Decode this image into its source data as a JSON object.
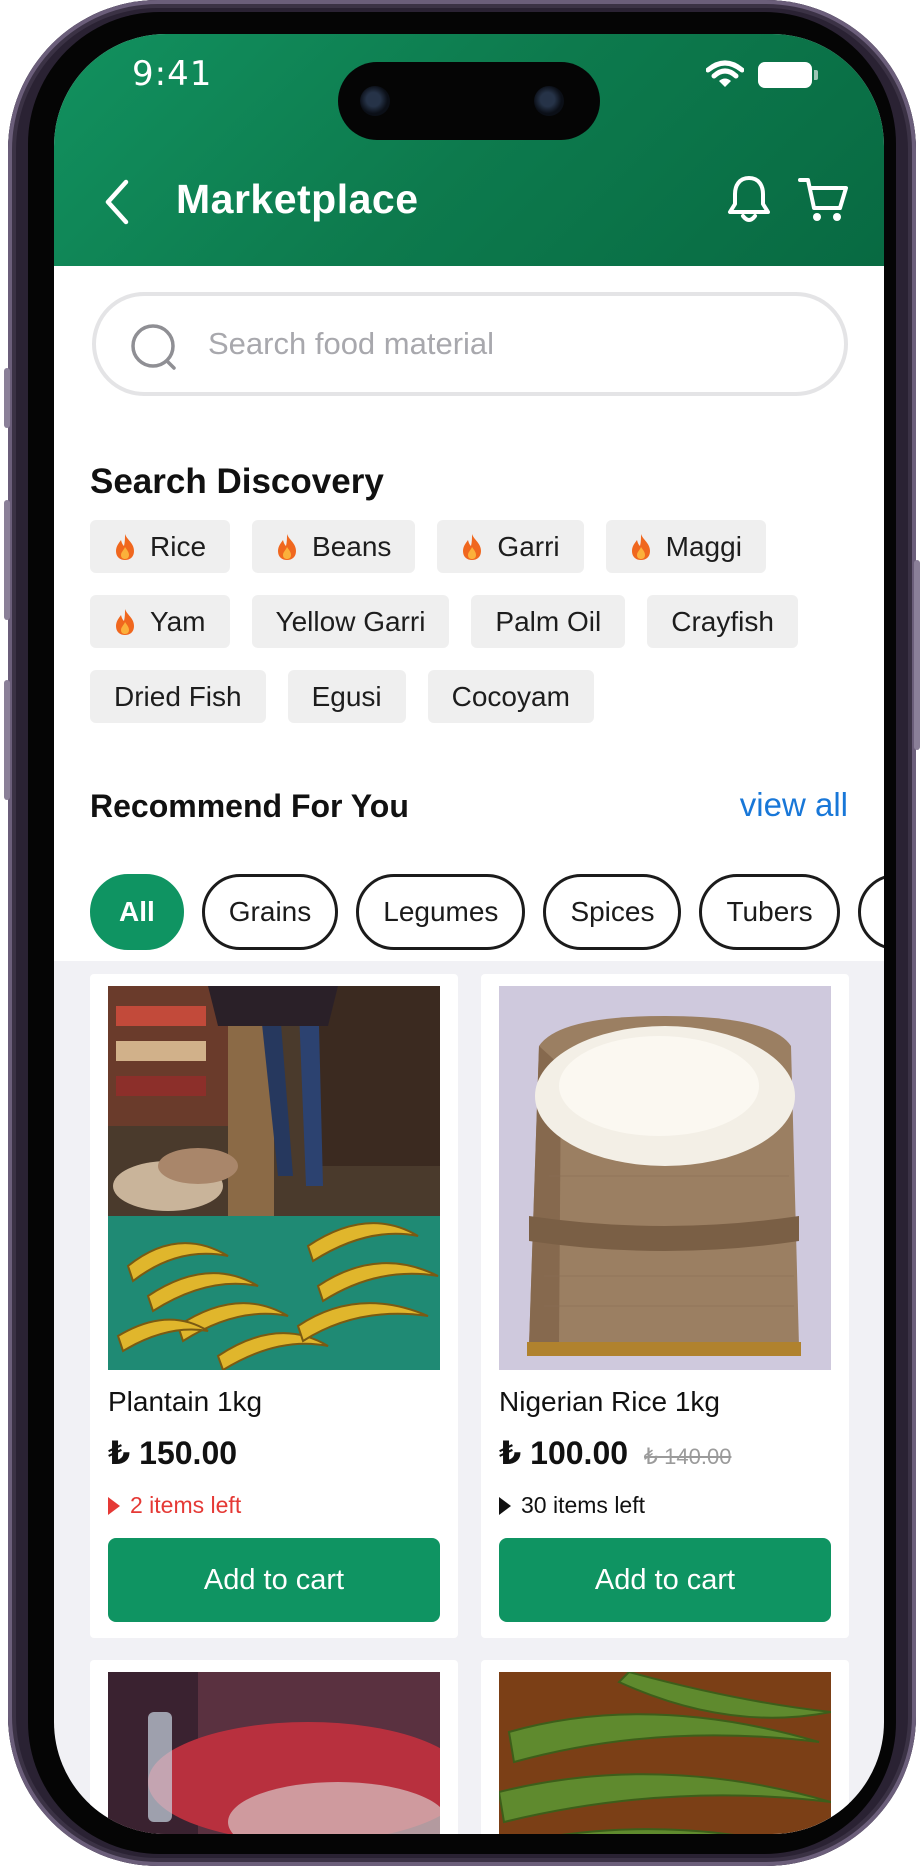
{
  "status_bar": {
    "time": "9:41"
  },
  "header": {
    "title": "Marketplace"
  },
  "search": {
    "placeholder": "Search food material"
  },
  "discovery": {
    "title": "Search Discovery",
    "rows": [
      [
        {
          "label": "Rice",
          "hot": true
        },
        {
          "label": "Beans",
          "hot": true
        },
        {
          "label": "Garri",
          "hot": true
        },
        {
          "label": "Maggi",
          "hot": true
        }
      ],
      [
        {
          "label": "Yam",
          "hot": true
        },
        {
          "label": "Yellow Garri",
          "hot": false
        },
        {
          "label": "Palm Oil",
          "hot": false
        },
        {
          "label": "Crayfish",
          "hot": false
        }
      ],
      [
        {
          "label": "Dried Fish",
          "hot": false
        },
        {
          "label": "Egusi",
          "hot": false
        },
        {
          "label": "Cocoyam",
          "hot": false
        }
      ]
    ]
  },
  "recommend": {
    "title": "Recommend For You",
    "view_all": "view all",
    "tabs": [
      "All",
      "Grains",
      "Legumes",
      "Spices",
      "Tubers",
      ""
    ],
    "active_tab": "All"
  },
  "products": [
    {
      "name": "Plantain 1kg",
      "price": "₺ 150.00",
      "old_price": "",
      "stock": "2 items left",
      "stock_color": "#e53935",
      "button": "Add to cart"
    },
    {
      "name": "Nigerian Rice 1kg",
      "price": "₺ 100.00",
      "old_price": "₺ 140.00",
      "stock": "30 items left",
      "stock_color": "#111111",
      "button": "Add to cart"
    }
  ],
  "colors": {
    "brand": "#0f9462",
    "link": "#1877d8",
    "alert": "#e53935"
  },
  "icons": [
    "back-chevron-icon",
    "bell-icon",
    "cart-icon",
    "search-icon",
    "fire-icon",
    "wifi-icon",
    "battery-icon"
  ]
}
